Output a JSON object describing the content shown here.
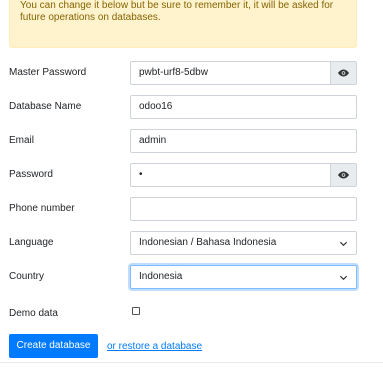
{
  "notice": {
    "line1": "You can change it below but be sure to remember it, it will be asked for",
    "line2": "future operations on databases."
  },
  "form": {
    "master_password": {
      "label": "Master Password",
      "value": "pwbt-urf8-5dbw"
    },
    "database_name": {
      "label": "Database Name",
      "value": "odoo16"
    },
    "email": {
      "label": "Email",
      "value": "admin"
    },
    "password": {
      "label": "Password",
      "value": "•"
    },
    "phone_number": {
      "label": "Phone number",
      "value": ""
    },
    "language": {
      "label": "Language",
      "value": "Indonesian / Bahasa Indonesia"
    },
    "country": {
      "label": "Country",
      "value": "Indonesia"
    },
    "demo_data": {
      "label": "Demo data",
      "checked": false
    }
  },
  "actions": {
    "create_label": "Create database",
    "restore_label": "or restore a database"
  },
  "icons": {
    "show_password": "eye-icon",
    "dropdown": "chevron-down-icon"
  },
  "colors": {
    "primary": "#007bff",
    "notice_bg": "#fff3cd",
    "notice_text": "#856404"
  }
}
